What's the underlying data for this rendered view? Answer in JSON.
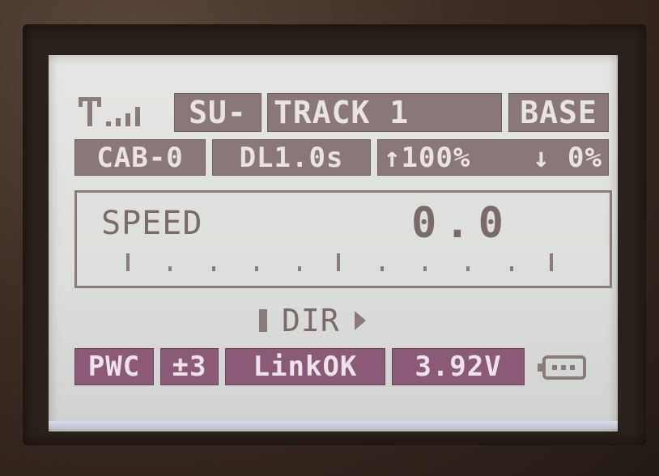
{
  "top_row": {
    "mode": "SU-",
    "track": "TRACK 1",
    "base": "BASE"
  },
  "second_row": {
    "cab": "CAB-0",
    "delay": "DL1.0s",
    "up": "↑100%",
    "down": "↓ 0%"
  },
  "speed_panel": {
    "label": "SPEED",
    "value": "0.0",
    "level": 0
  },
  "direction": {
    "label": "DIR"
  },
  "status_row": {
    "pwm": "PWC",
    "step": "±3",
    "link": "LinkOK",
    "voltage": "3.92V"
  },
  "icons": {
    "signal": "signal-strength-icon",
    "battery": "battery-icon",
    "dir_left": "stop-bar-icon",
    "dir_right": "forward-arrow-icon"
  },
  "colors": {
    "lcd_background": "#dcdedb",
    "segment_gray": "#8a7878",
    "segment_purple": "#8b5a76"
  }
}
